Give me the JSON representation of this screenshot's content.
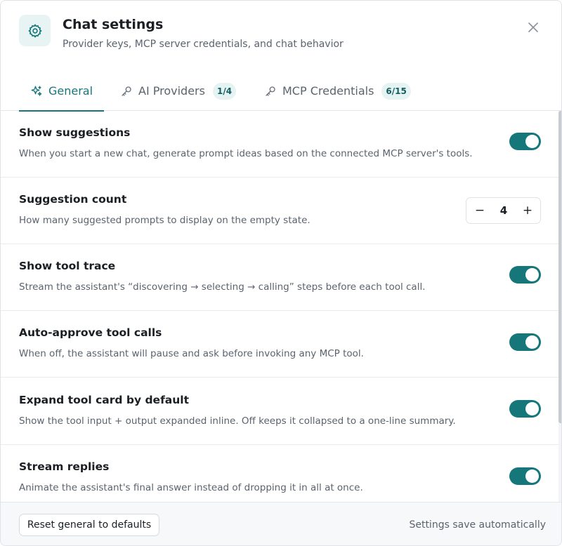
{
  "header": {
    "icon": "gear-icon",
    "title": "Chat settings",
    "subtitle": "Provider keys, MCP server credentials, and chat behavior",
    "close_icon": "close-icon"
  },
  "tabs": [
    {
      "label": "General",
      "icon": "sparkles-icon",
      "active": true
    },
    {
      "label": "AI Providers",
      "icon": "key-icon",
      "badge": "1/4",
      "active": false
    },
    {
      "label": "MCP Credentials",
      "icon": "key-icon",
      "badge": "6/15",
      "active": false
    }
  ],
  "settings": [
    {
      "title": "Show suggestions",
      "description": "When you start a new chat, generate prompt ideas based on the connected MCP server's tools.",
      "control": "toggle",
      "enabled": true
    },
    {
      "title": "Suggestion count",
      "description": "How many suggested prompts to display on the empty state.",
      "control": "stepper",
      "value": "4",
      "minus_label": "−",
      "plus_label": "+"
    },
    {
      "title": "Show tool trace",
      "description": "Stream the assistant's “discovering → selecting → calling” steps before each tool call.",
      "control": "toggle",
      "enabled": true
    },
    {
      "title": "Auto-approve tool calls",
      "description": "When off, the assistant will pause and ask before invoking any MCP tool.",
      "control": "toggle",
      "enabled": true
    },
    {
      "title": "Expand tool card by default",
      "description": "Show the tool input + output expanded inline. Off keeps it collapsed to a one-line summary.",
      "control": "toggle",
      "enabled": true
    },
    {
      "title": "Stream replies",
      "description": "Animate the assistant's final answer instead of dropping it in all at once.",
      "control": "toggle",
      "enabled": true
    }
  ],
  "footer": {
    "reset_label": "Reset general to defaults",
    "status_text": "Settings save automatically"
  },
  "colors": {
    "accent": "#16777a",
    "badge_bg": "#e6f3f3",
    "footer_bg": "#f6f8fa",
    "text_primary": "#1b1f24",
    "text_secondary": "#5b636d"
  }
}
